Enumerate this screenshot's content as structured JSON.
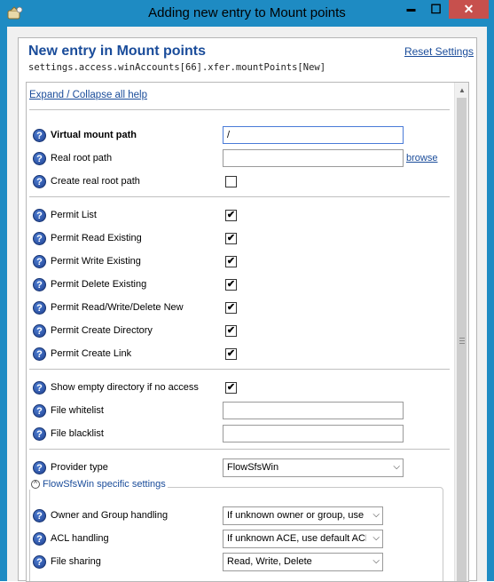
{
  "window": {
    "title": "Adding new entry to Mount points",
    "minimize_glyph": "▬",
    "maximize_glyph": "☐",
    "close_glyph": "✕"
  },
  "header": {
    "title": "New entry in Mount points",
    "reset_label": "Reset Settings",
    "path": "settings.access.winAccounts[66].xfer.mountPoints[New]"
  },
  "expand_label": "Expand / Collapse all help",
  "help_glyph": "?",
  "check_glyph": "✔",
  "fields": {
    "virtual_mount_path": {
      "label": "Virtual mount path",
      "value": "/"
    },
    "real_root_path": {
      "label": "Real root path",
      "value": "",
      "browse_label": "browse"
    },
    "create_real_root_path": {
      "label": "Create real root path",
      "checked": false
    },
    "permit_list": {
      "label": "Permit List",
      "checked": true
    },
    "permit_read_existing": {
      "label": "Permit Read Existing",
      "checked": true
    },
    "permit_write_existing": {
      "label": "Permit Write Existing",
      "checked": true
    },
    "permit_delete_existing": {
      "label": "Permit Delete Existing",
      "checked": true
    },
    "permit_rwd_new": {
      "label": "Permit Read/Write/Delete New",
      "checked": true
    },
    "permit_create_directory": {
      "label": "Permit Create Directory",
      "checked": true
    },
    "permit_create_link": {
      "label": "Permit Create Link",
      "checked": true
    },
    "show_empty_directory": {
      "label": "Show empty directory if no access",
      "checked": true
    },
    "file_whitelist": {
      "label": "File whitelist",
      "value": ""
    },
    "file_blacklist": {
      "label": "File blacklist",
      "value": ""
    },
    "provider_type": {
      "label": "Provider type",
      "value": "FlowSfsWin"
    }
  },
  "group": {
    "legend": "FlowSfsWin specific settings",
    "collapse_glyph": "^",
    "owner_group_handling": {
      "label": "Owner and Group handling",
      "value": "If unknown owner or group, use"
    },
    "acl_handling": {
      "label": "ACL handling",
      "value": "If unknown ACE, use default ACL"
    },
    "file_sharing": {
      "label": "File sharing",
      "value": "Read, Write, Delete"
    }
  },
  "colors": {
    "titlebar": "#1e8bc3",
    "close_button": "#c7504d",
    "link": "#1a4c9a",
    "help_icon": "#1e3f8f"
  }
}
